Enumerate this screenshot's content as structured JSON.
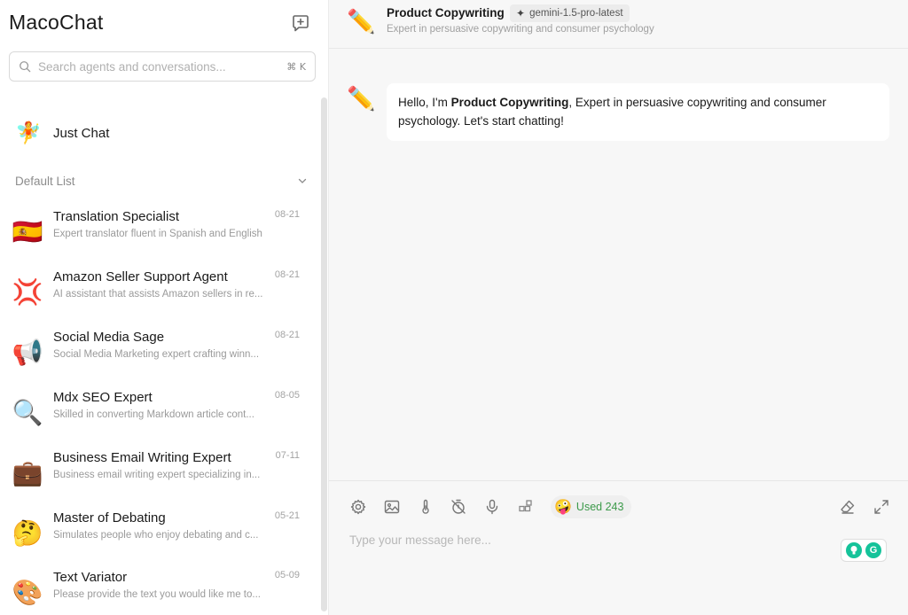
{
  "sidebar": {
    "brand": "MacoChat",
    "search": {
      "placeholder": "Search agents and conversations...",
      "shortcut": "⌘ K"
    },
    "just_chat": {
      "emoji": "🧚",
      "label": "Just Chat"
    },
    "group": {
      "label": "Default List"
    },
    "agents": [
      {
        "emoji": "🇪🇸",
        "title": "Translation Specialist",
        "desc": "Expert translator fluent in Spanish and English",
        "date": "08-21"
      },
      {
        "emoji": "💢",
        "title": "Amazon Seller Support Agent",
        "desc": "AI assistant that assists Amazon sellers in re...",
        "date": "08-21"
      },
      {
        "emoji": "📢",
        "title": "Social Media Sage",
        "desc": "Social Media Marketing expert crafting winn...",
        "date": "08-21"
      },
      {
        "emoji": "🔍",
        "title": "Mdx SEO Expert",
        "desc": "Skilled in converting Markdown article cont...",
        "date": "08-05"
      },
      {
        "emoji": "💼",
        "title": "Business Email Writing Expert",
        "desc": "Business email writing expert specializing in...",
        "date": "07-11"
      },
      {
        "emoji": "🤔",
        "title": "Master of Debating",
        "desc": "Simulates people who enjoy debating and c...",
        "date": "05-21"
      },
      {
        "emoji": "🎨",
        "title": "Text Variator",
        "desc": "Please provide the text you would like me to...",
        "date": "05-09"
      }
    ]
  },
  "header": {
    "avatar": "✏️",
    "title": "Product Copywriting",
    "model": "gemini-1.5-pro-latest",
    "model_icon": "✦",
    "subtitle": "Expert in persuasive copywriting and consumer psychology"
  },
  "message": {
    "avatar": "✏️",
    "prefix": "Hello, I'm ",
    "name": "Product Copywriting",
    "suffix": ", Expert in persuasive copywriting and consumer psychology. Let's start chatting!"
  },
  "composer": {
    "used_emoji": "🤪",
    "used_label": "Used 243",
    "placeholder": "Type your message here...",
    "grammarly_letter": "G"
  },
  "colors": {
    "accent_green": "#3c9a4a",
    "grammarly": "#15c39a"
  }
}
